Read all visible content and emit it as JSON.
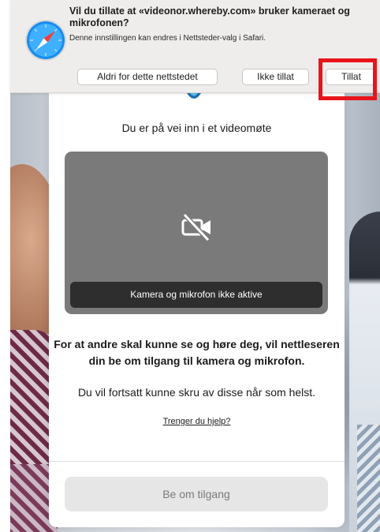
{
  "permission_prompt": {
    "title": "Vil du tillate at «videonor.whereby.com» bruker kameraet og mikrofonen?",
    "subtitle": "Denne innstillingen kan endres i Nettsteder-valg i Safari.",
    "never_label": "Aldri for dette nettstedet",
    "deny_label": "Ikke tillat",
    "allow_label": "Tillat",
    "app_icon": "safari-compass-icon",
    "highlight_color": "#e8141b"
  },
  "modal": {
    "title": "Du er på vei inn i et videomøte",
    "preview": {
      "icon": "camera-off-icon",
      "status": "Kamera og mikrofon ikke aktive"
    },
    "explanation": "For at andre skal kunne se og høre deg, vil nettleseren din be om tilgang til kamera og mikrofon.",
    "explanation_line2": "Du vil fortsatt kunne skru av disse når som helst.",
    "help_link": "Trenger du hjelp?",
    "request_button": "Be om tilgang"
  }
}
